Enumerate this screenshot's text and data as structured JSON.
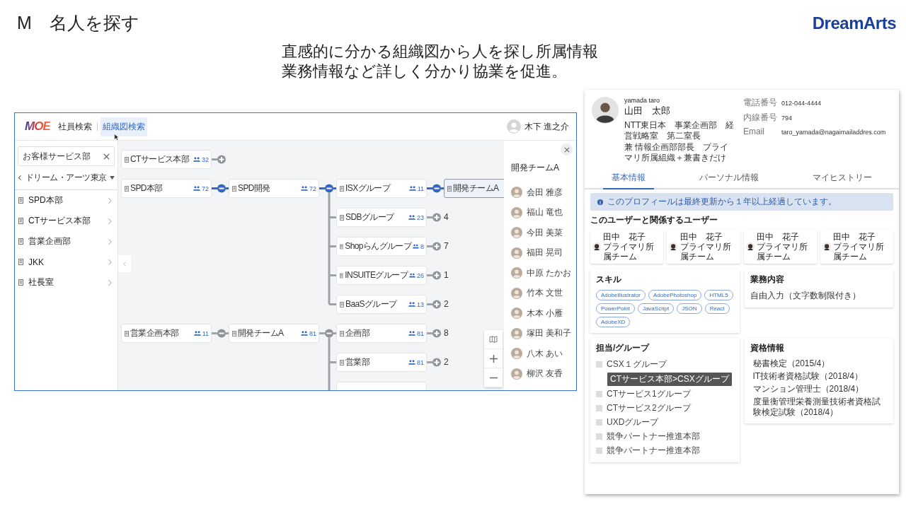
{
  "slide": {
    "title": "M　名人を探す",
    "brand": "DreamArts",
    "subtitle": [
      "直感的に分かる組織図から人を探し所属情報",
      "業務情報など詳しく分かり協業を促進。"
    ]
  },
  "org_screen": {
    "header": {
      "logo": "MOE",
      "tabs": [
        {
          "label": "社員検索",
          "selected": false
        },
        {
          "label": "組織図検索",
          "selected": true
        }
      ],
      "user": "木下 進之介"
    },
    "sidebar": {
      "search": {
        "value": "お客様サービス部"
      },
      "breadcrumb": "ドリーム・アーツ東京",
      "items": [
        "SPD本部",
        "CTサービス本部",
        "営業企画部",
        "JKK",
        "社長室"
      ]
    },
    "org_chart": {
      "nodes": [
        {
          "label": "CTサービス本部",
          "count": "32",
          "selected": false,
          "expanded": false
        },
        {
          "label": "SPD本部",
          "count": "72",
          "selected": false,
          "expanded": true,
          "children": [
            {
              "label": "SPD開発",
              "count": "72",
              "selected": false,
              "expanded": true,
              "children": [
                {
                  "label": "ISXグループ",
                  "count": "11",
                  "selected": false,
                  "expanded": true,
                  "children": [
                    {
                      "label": "開発チームA",
                      "selected": true
                    }
                  ]
                },
                {
                  "label": "SDBグループ",
                  "count": "23",
                  "selected": false,
                  "expanded": false,
                  "hidden_count": "4"
                },
                {
                  "label": "Shopらんグループ",
                  "count": "8",
                  "selected": false,
                  "expanded": false,
                  "hidden_count": "7"
                },
                {
                  "label": "INSUITEグループ",
                  "count": "26",
                  "selected": false,
                  "expanded": false,
                  "hidden_count": "1"
                },
                {
                  "label": "BaaSグループ",
                  "count": "13",
                  "selected": false,
                  "expanded": false,
                  "hidden_count": "2"
                }
              ]
            }
          ]
        },
        {
          "label": "営業企画本部",
          "count": "11",
          "selected": false,
          "expanded": true,
          "children": [
            {
              "label": "開発チームA",
              "count": "81",
              "selected": false,
              "expanded": true,
              "children": [
                {
                  "label": "企画部",
                  "count": "81",
                  "selected": false,
                  "expanded": false,
                  "hidden_count": "8"
                },
                {
                  "label": "営業部",
                  "count": "81",
                  "selected": false,
                  "expanded": false,
                  "hidden_count": "2"
                },
                {
                  "stub": true,
                  "selected": false
                }
              ]
            }
          ]
        }
      ]
    },
    "panel": {
      "title": "開発チームA",
      "members": [
        "会田 雅彦",
        "福山 竜也",
        "今田 美菜",
        "福田 晃司",
        "中原 たかお",
        "竹本 文世",
        "木本 小雁",
        "塚田 美和子",
        "八木 あい",
        "柳沢 友香"
      ]
    }
  },
  "profile_screen": {
    "romaji": "yamada taro",
    "name": "山田　太郎",
    "affiliations": [
      "NTT東日本　事業企画部　経営戦略室　第二室長",
      "兼 情報企画部部長　プライマリ所属組織＋兼書きだけ"
    ],
    "contacts": [
      {
        "label": "電話番号",
        "value": "012-044-4444"
      },
      {
        "label": "内線番号",
        "value": "794"
      },
      {
        "label": "Email",
        "value": "taro_yamada@nagaimailaddres.com"
      }
    ],
    "tabs": [
      {
        "label": "基本情報",
        "selected": true
      },
      {
        "label": "パーソナル情報",
        "selected": false
      },
      {
        "label": "マイヒストリー",
        "selected": false
      }
    ],
    "notice": "このプロフィールは最終更新から１年以上経過しています。",
    "related_heading": "このユーザーと関係するユーザー",
    "related_users": [
      {
        "name": "田中　花子",
        "team": "プライマリ所属チーム"
      },
      {
        "name": "田中　花子",
        "team": "プライマリ所属チーム"
      },
      {
        "name": "田中　花子",
        "team": "プライマリ所属チーム"
      },
      {
        "name": "田中　花子",
        "team": "プライマリ所属チーム"
      }
    ],
    "skills": {
      "title": "スキル",
      "tags": [
        "AdobeIllustrator",
        "AdobePhotoshop",
        "HTML5",
        "PowerPoint",
        "JavaScript",
        "JSON",
        "React",
        "AdobeXD"
      ]
    },
    "duties": {
      "title": "業務内容",
      "text": "自由入力（文字数制限付き）"
    },
    "groups": {
      "title": "担当/グループ",
      "items": [
        {
          "label": "CSX１グループ",
          "checked": false,
          "tooltip": "CTサービス本部>CSXグループ"
        },
        {
          "label": "CTサービス1グループ",
          "checked": false
        },
        {
          "label": "CTサービス2グループ",
          "checked": false
        },
        {
          "label": "UXDグループ",
          "checked": false
        },
        {
          "label": "競争パートナー推進本部",
          "checked": false
        },
        {
          "label": "競争パートナー推進本部",
          "checked": false
        }
      ]
    },
    "qualifications": {
      "title": "資格情報",
      "items": [
        "秘書検定（2015/4）",
        "IT技術者資格試験（2018/4）",
        "マンション管理士（2018/4）",
        "度量衡管理栄養測量技術者資格試験検定試験（2018/4）"
      ]
    }
  }
}
